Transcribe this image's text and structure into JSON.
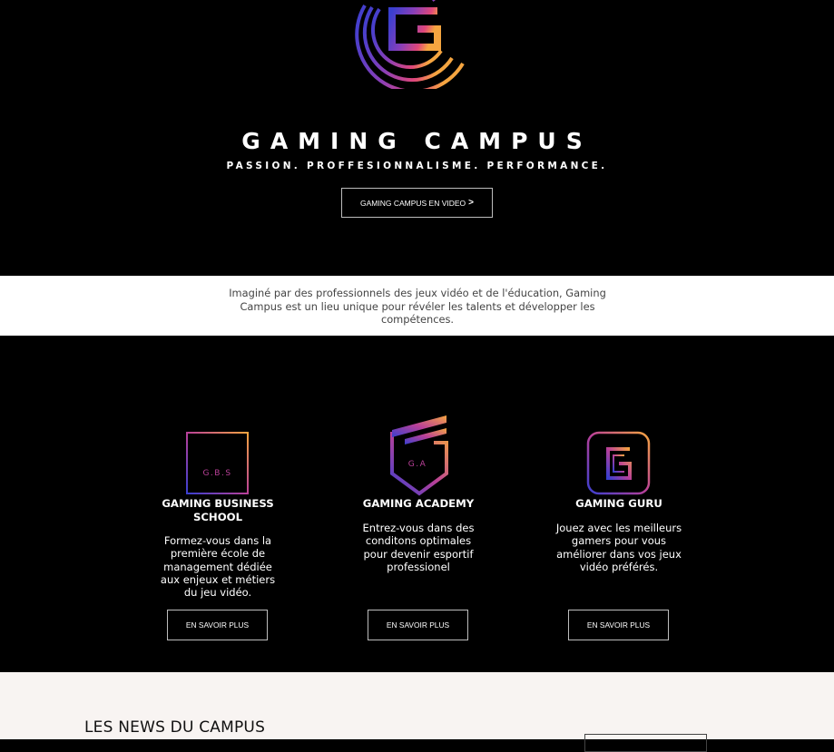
{
  "hero": {
    "brand": "GAMING CAMPUS",
    "tagline": "PASSION. PROFFESIONNALISME. PERFORMANCE.",
    "video_button": "GAMING CAMPUS EN VIDEO",
    "video_button_arrow": ">",
    "gradient": [
      "#3a3fd0",
      "#8a3fb8",
      "#e0477a",
      "#f5a540"
    ]
  },
  "intro": {
    "text": "Imaginé par des professionnels des jeux vidéo et de l'éducation, Gaming Campus est un lieu unique pour révéler les talents et développer les compétences."
  },
  "schools": [
    {
      "icon_text": "G.B.S",
      "title": "GAMING BUSINESS SCHOOL",
      "description": "Formez-vous dans la première école de management dédiée aux enjeux et métiers du jeu vidéo.",
      "button": "EN SAVOIR PLUS"
    },
    {
      "icon_text": "G.A",
      "title": "GAMING ACADEMY",
      "description": "Entrez-vous dans des conditons optimales pour devenir esportif professionel",
      "button": "EN SAVOIR PLUS"
    },
    {
      "icon_text": "G",
      "title": "GAMING GURU",
      "description": "Jouez avec les meilleurs gamers pour vous améliorer dans vos jeux vidéo préférés.",
      "button": "EN SAVOIR PLUS"
    }
  ],
  "news": {
    "title": "LES NEWS DU CAMPUS"
  }
}
